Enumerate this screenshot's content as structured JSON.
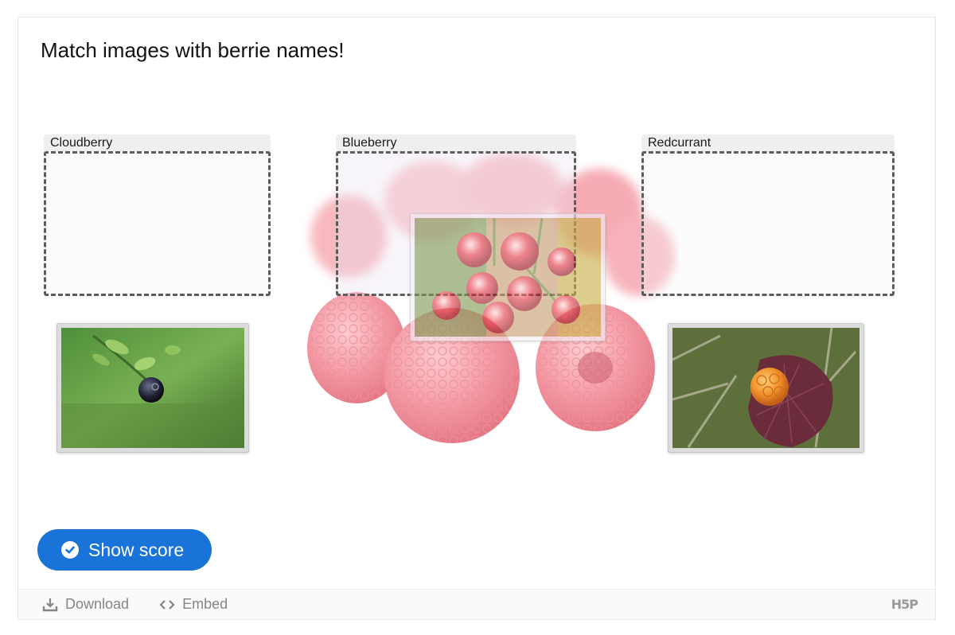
{
  "title": "Match images with berrie names!",
  "dropzones": [
    {
      "label": "Cloudberry"
    },
    {
      "label": "Blueberry"
    },
    {
      "label": "Redcurrant"
    }
  ],
  "draggables": [
    {
      "depicts": "blueberry"
    },
    {
      "depicts": "redcurrant"
    },
    {
      "depicts": "cloudberry"
    }
  ],
  "actions": {
    "show_score": "Show score"
  },
  "footer": {
    "download": "Download",
    "embed": "Embed",
    "logo": "H5P"
  },
  "colors": {
    "button": "#1a73d9",
    "dropzone_border": "#5c5c5c"
  },
  "icons": {
    "show_score": "check-circle-icon",
    "download": "download-icon",
    "embed": "code-icon"
  }
}
